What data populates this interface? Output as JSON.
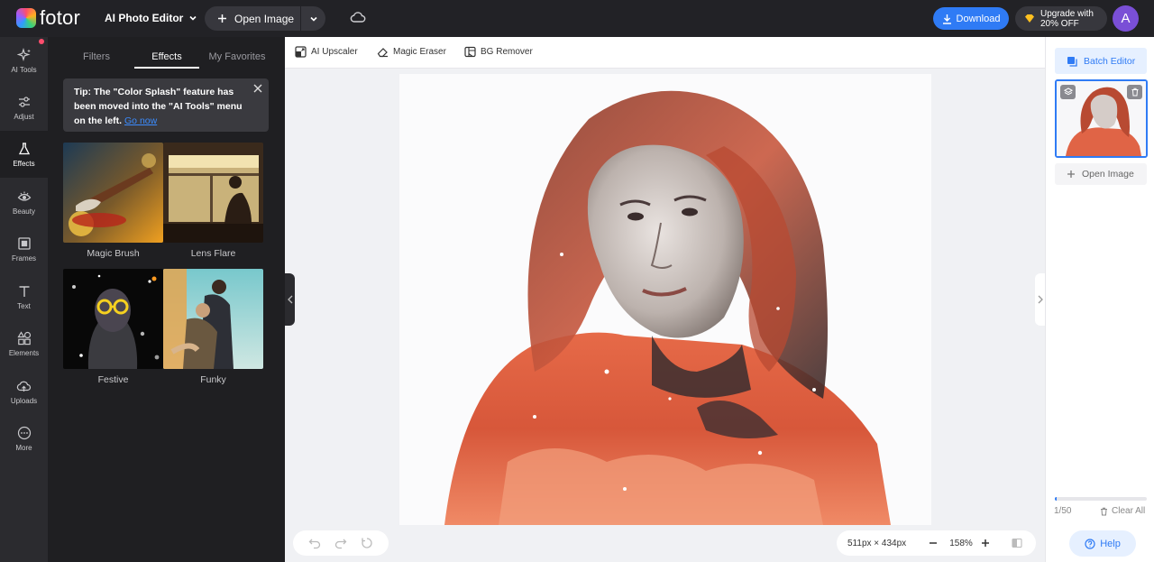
{
  "app": {
    "brand": "fotor",
    "mode_label": "AI Photo Editor"
  },
  "header": {
    "open_image_label": "Open Image",
    "download_label": "Download",
    "upgrade_line1": "Upgrade with",
    "upgrade_line2": "20% OFF",
    "avatar_initial": "A"
  },
  "rail": {
    "items": [
      {
        "label": "AI Tools",
        "icon": "sparkle-icon"
      },
      {
        "label": "Adjust",
        "icon": "sliders-icon"
      },
      {
        "label": "Effects",
        "icon": "flask-icon"
      },
      {
        "label": "Beauty",
        "icon": "eye-icon"
      },
      {
        "label": "Frames",
        "icon": "frame-icon"
      },
      {
        "label": "Text",
        "icon": "text-icon"
      },
      {
        "label": "Elements",
        "icon": "shapes-icon"
      },
      {
        "label": "Uploads",
        "icon": "cloud-upload-icon"
      },
      {
        "label": "More",
        "icon": "more-icon"
      }
    ]
  },
  "panel": {
    "tabs": [
      {
        "label": "Filters"
      },
      {
        "label": "Effects"
      },
      {
        "label": "My Favorites"
      }
    ],
    "tip": {
      "text": "Tip: The \"Color Splash\" feature has been moved into the \"AI Tools\" menu on the left.",
      "link": "Go now"
    },
    "effects": [
      {
        "label": "Magic Brush"
      },
      {
        "label": "Lens Flare"
      },
      {
        "label": "Festive"
      },
      {
        "label": "Funky"
      }
    ]
  },
  "toolbar": {
    "upscaler": "AI Upscaler",
    "eraser": "Magic Eraser",
    "bg_remover": "BG Remover"
  },
  "canvas": {
    "dimensions": "511px × 434px",
    "zoom": "158%"
  },
  "right_panel": {
    "batch_label": "Batch Editor",
    "open_image_label": "Open Image",
    "count": "1/50",
    "clear_label": "Clear All",
    "help_label": "Help",
    "progress_fraction": 0.02
  },
  "colors": {
    "accent": "#2f7bf5",
    "topbar": "#222226",
    "panel": "#1f1f22",
    "rail": "#2b2b2f"
  }
}
